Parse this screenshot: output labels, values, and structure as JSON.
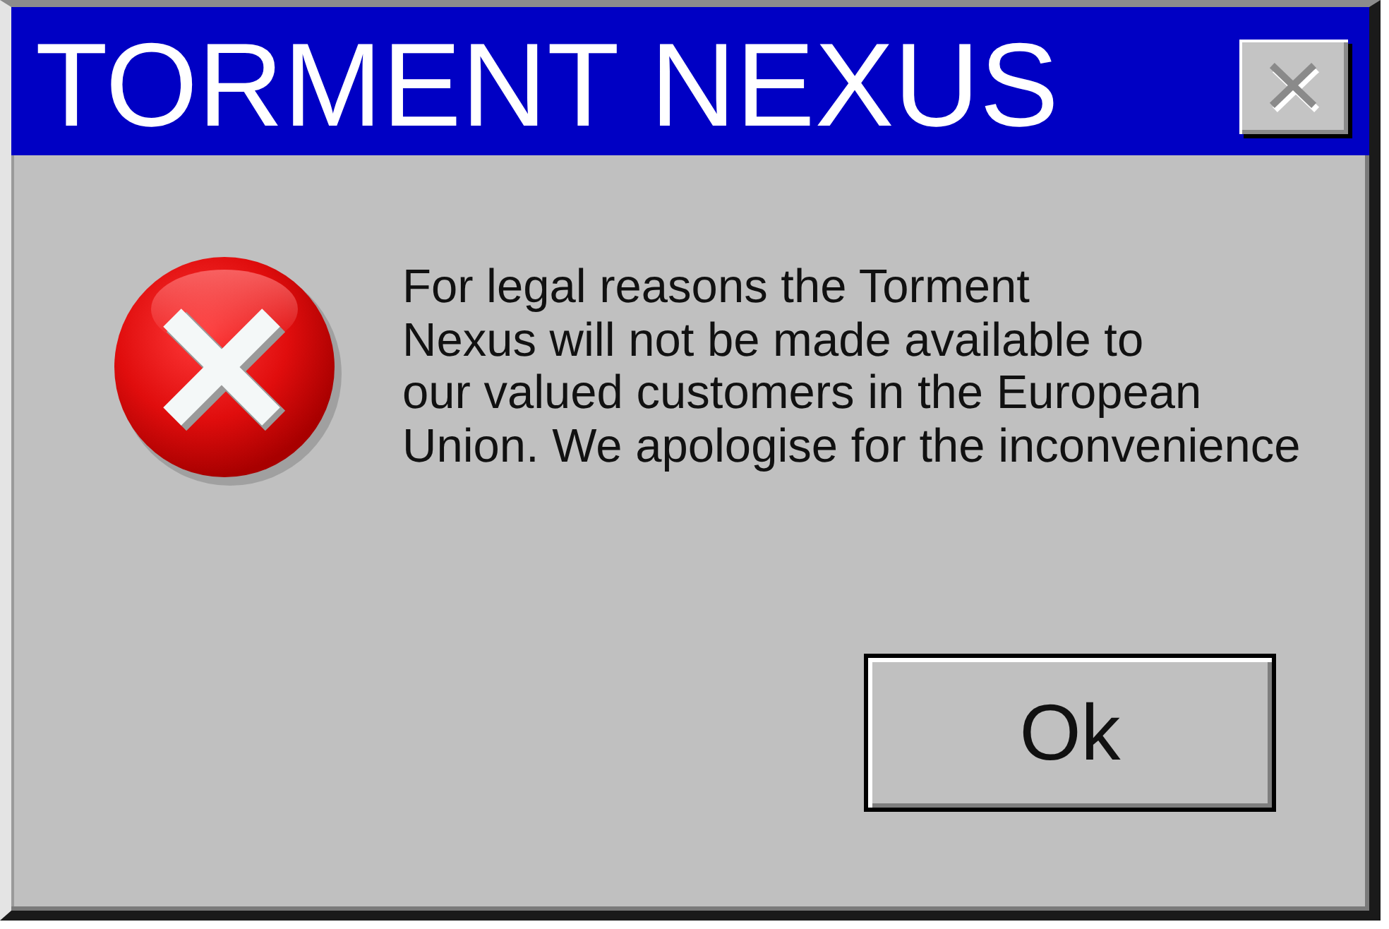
{
  "window": {
    "title": "TORMENT NEXUS",
    "close_button": {
      "disabled": true
    }
  },
  "message": "For legal reasons the Torment\nNexus will not be made available to\nour valued customers in the European\nUnion. We apologise for the inconvenience",
  "buttons": [
    {
      "label": "Ok"
    }
  ]
}
